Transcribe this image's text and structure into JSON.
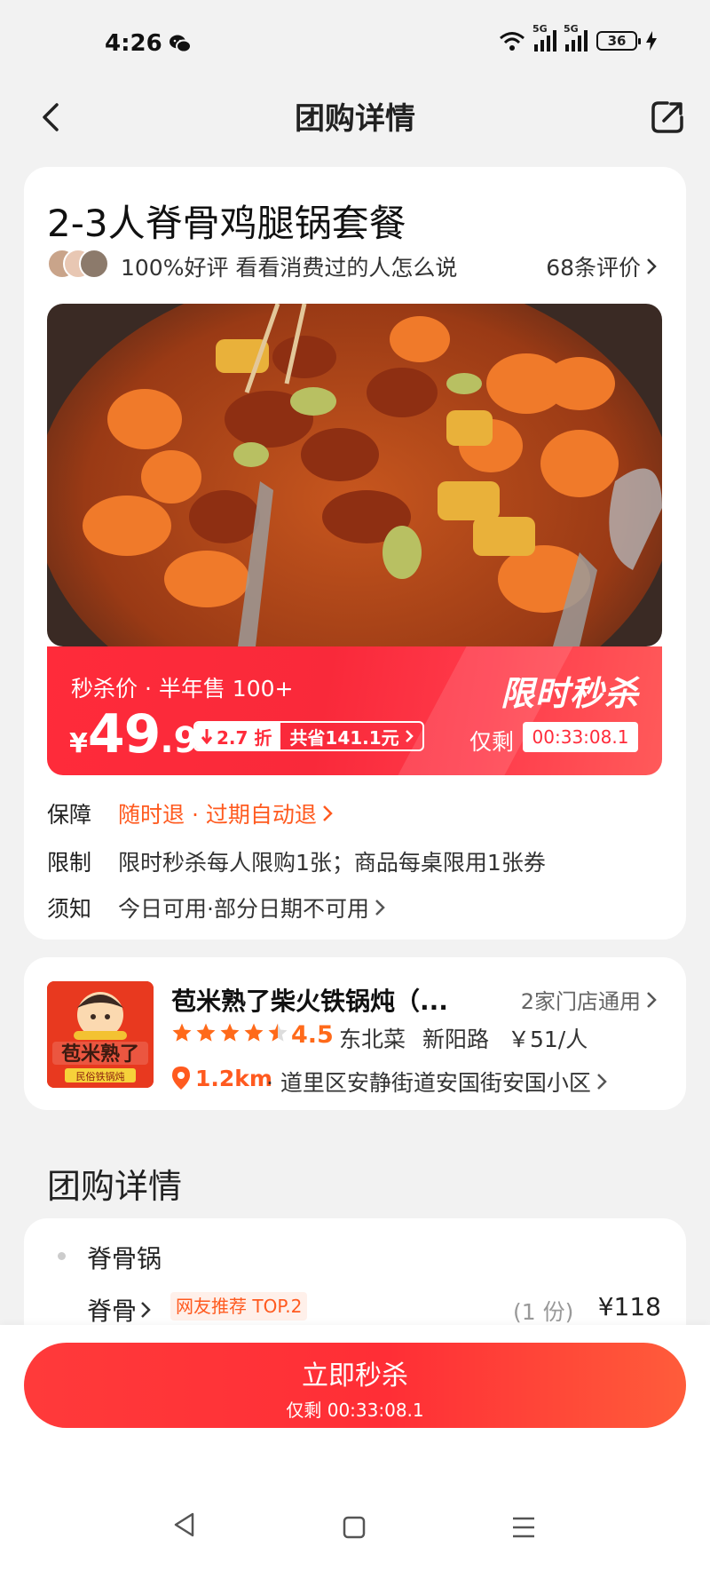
{
  "status_bar": {
    "time": "4:26",
    "network_1": "5G",
    "network_2": "5G",
    "battery": "36"
  },
  "nav": {
    "title": "团购详情",
    "back_icon": "chevron-left-icon",
    "share_icon": "share-icon"
  },
  "deal": {
    "title": "2-3人脊骨鸡腿锅套餐",
    "review_rate": "100%好评  看看消费过的人怎么说",
    "review_count": "68条评价",
    "flash": {
      "sub": "秒杀价 · 半年售 100+",
      "currency": "¥",
      "price_int": "49",
      "price_dec": ".9",
      "discount": "2.7 折",
      "save": "共省141.1元",
      "label": "限时秒杀",
      "remain_label": "仅剩",
      "countdown": "00:33:08.1"
    },
    "rows": {
      "guarantee_key": "保障",
      "guarantee_val": "随时退 · 过期自动退",
      "limit_key": "限制",
      "limit_val": "限时秒杀每人限购1张；商品每桌限用1张券",
      "notice_key": "须知",
      "notice_val": "今日可用·部分日期不可用"
    }
  },
  "store": {
    "logo_text": "苞米熟了",
    "logo_sub": "民俗铁锅炖",
    "name": "苞米熟了柴火铁锅炖（...",
    "branches": "2家门店通用",
    "rating": "4.5",
    "rating_value": 4.5,
    "category": "东北菜",
    "area": "新阳路",
    "price": "￥51/人",
    "distance": "1.2km",
    "address": "· 道里区安静街道安国街安国小区"
  },
  "detail": {
    "section_title": "团购详情",
    "group": "脊骨锅",
    "item_name": "脊骨",
    "item_tag": "网友推荐 TOP.2",
    "item_qty": "(1 份)",
    "item_price": "¥118"
  },
  "bottom": {
    "buy_label": "立即秒杀",
    "buy_remain": "仅剩 00:33:08.1"
  },
  "colors": {
    "accent": "#ff2b3a",
    "orange": "#ff5a1f",
    "card": "#ffffff",
    "background": "#f2f2f2"
  }
}
